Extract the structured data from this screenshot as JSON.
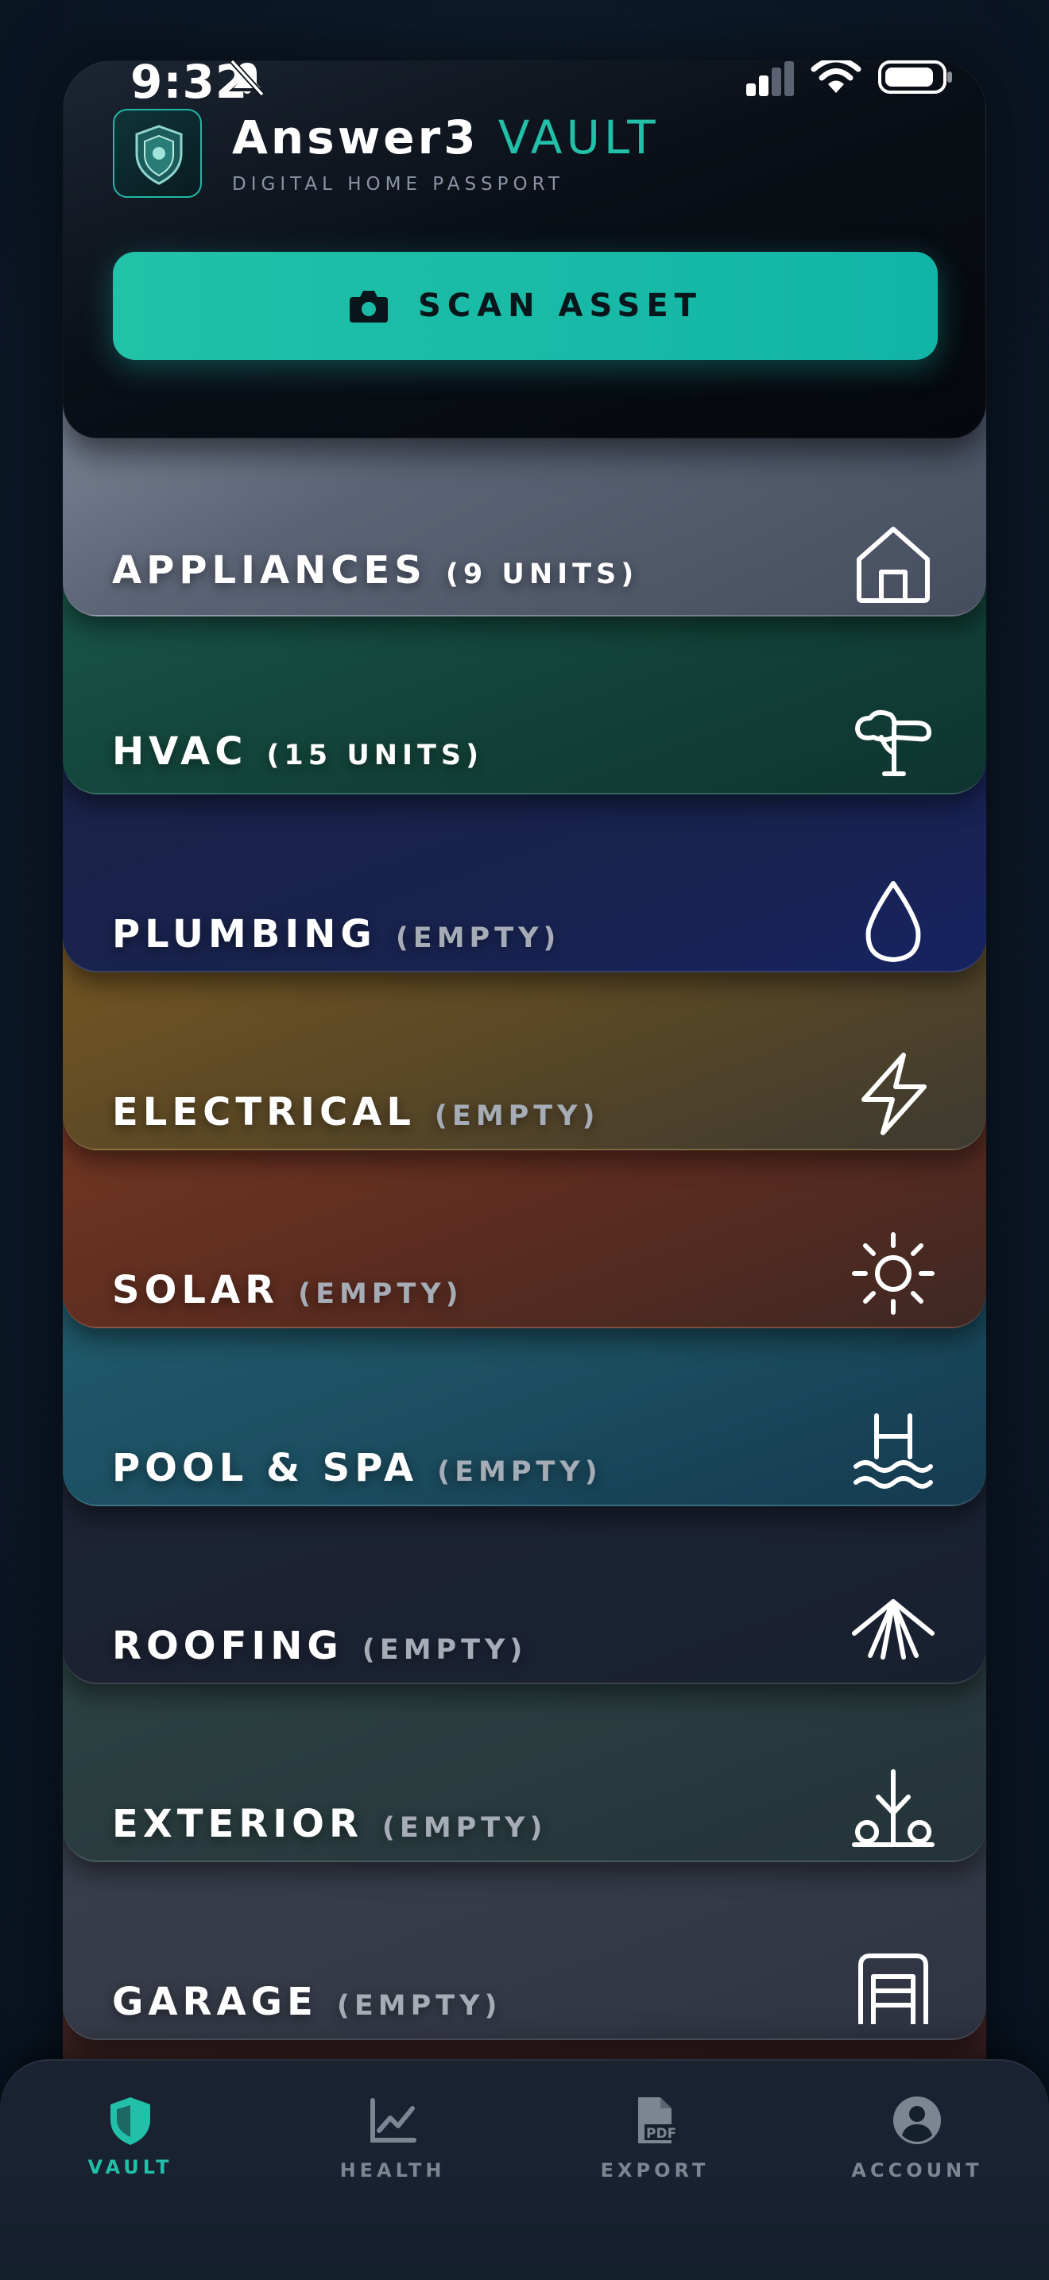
{
  "status_bar": {
    "time": "9:32"
  },
  "header": {
    "brand": "Answer3",
    "brand_accent": "VAULT",
    "subtitle": "DIGITAL HOME PASSPORT",
    "scan_button_label": "SCAN ASSET"
  },
  "categories": [
    {
      "name": "APPLIANCES",
      "count": "(9 UNITS)",
      "icon": "house-icon"
    },
    {
      "name": "HVAC",
      "count": "(15 UNITS)",
      "icon": "fan-icon"
    },
    {
      "name": "PLUMBING",
      "count": "(EMPTY)",
      "icon": "water-drop-icon"
    },
    {
      "name": "ELECTRICAL",
      "count": "(EMPTY)",
      "icon": "lightning-icon"
    },
    {
      "name": "SOLAR",
      "count": "(EMPTY)",
      "icon": "sun-icon"
    },
    {
      "name": "POOL & SPA",
      "count": "(EMPTY)",
      "icon": "pool-ladder-icon"
    },
    {
      "name": "ROOFING",
      "count": "(EMPTY)",
      "icon": "roof-icon"
    },
    {
      "name": "EXTERIOR",
      "count": "(EMPTY)",
      "icon": "plant-icon"
    },
    {
      "name": "GARAGE",
      "count": "(EMPTY)",
      "icon": "garage-icon"
    }
  ],
  "colors": {
    "accent": "#22bfa9",
    "appliances": "#6b7587",
    "hvac": "#164a40",
    "plumbing": "#1a2450",
    "electrical": "#6e5323",
    "solar": "#6e3222",
    "pool": "#1d5260",
    "roofing": "#1b2232",
    "exterior": "#2a3e3f",
    "garage": "#363b48"
  },
  "tabs": [
    {
      "label": "VAULT",
      "icon": "shield-icon",
      "active": true
    },
    {
      "label": "HEALTH",
      "icon": "chart-icon",
      "active": false
    },
    {
      "label": "EXPORT",
      "icon": "pdf-icon",
      "active": false
    },
    {
      "label": "ACCOUNT",
      "icon": "account-icon",
      "active": false
    }
  ]
}
